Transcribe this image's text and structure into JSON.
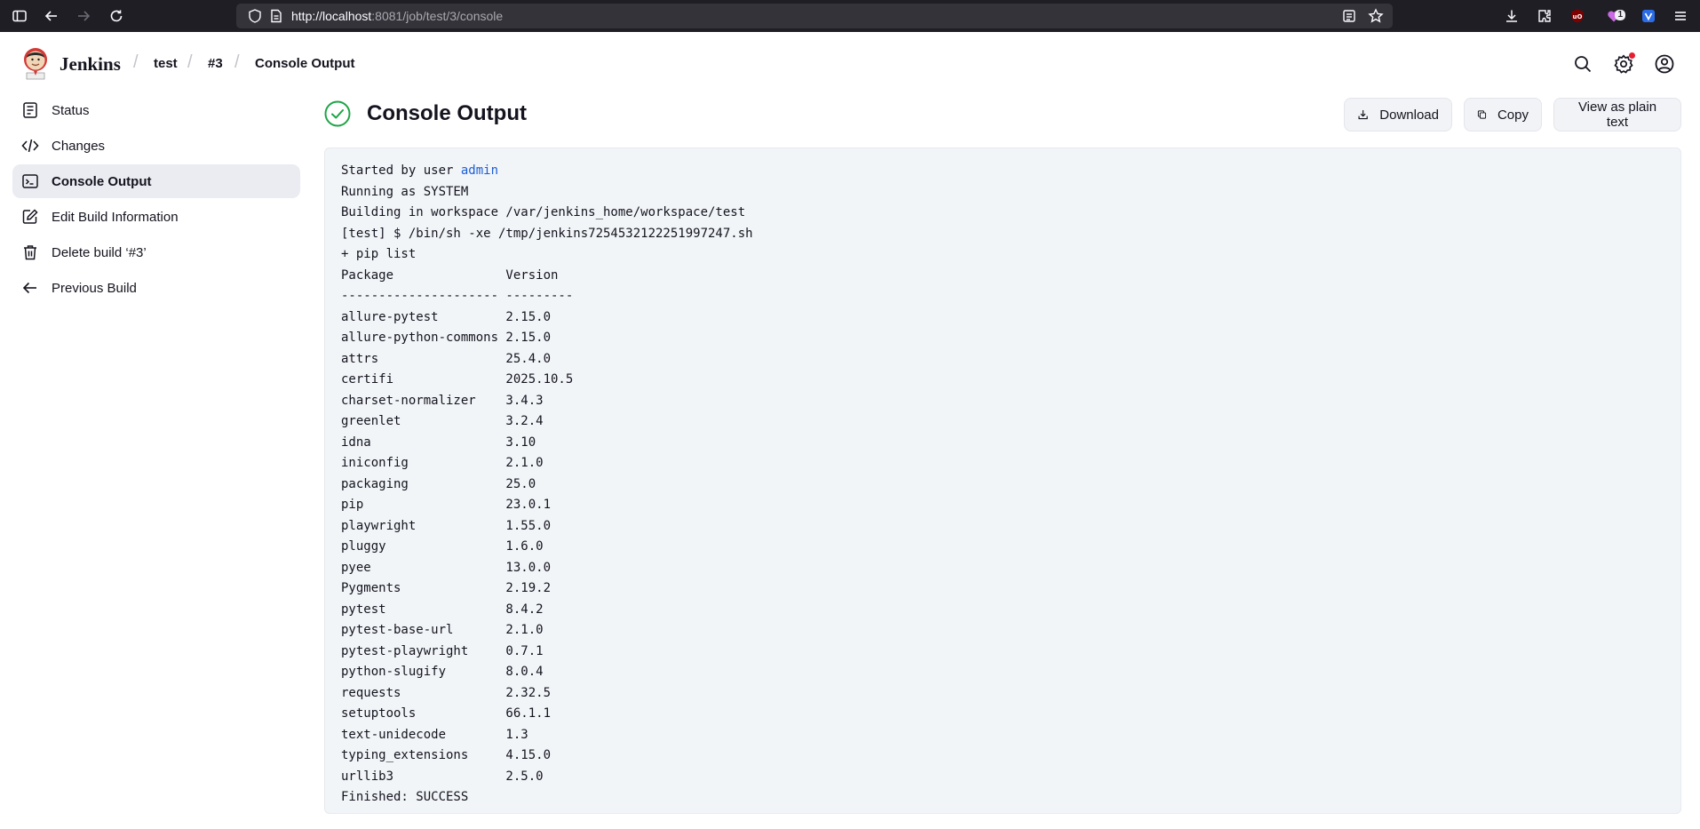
{
  "browser": {
    "url_host": "http://localhost",
    "url_rest": ":8081/job/test/3/console",
    "extension_badge": "1"
  },
  "header": {
    "brand": "Jenkins",
    "breadcrumbs": [
      "test",
      "#3",
      "Console Output"
    ]
  },
  "sidebar": {
    "items": [
      {
        "label": "Status",
        "icon": "status-icon"
      },
      {
        "label": "Changes",
        "icon": "code-icon"
      },
      {
        "label": "Console Output",
        "icon": "terminal-icon",
        "active": true
      },
      {
        "label": "Edit Build Information",
        "icon": "edit-icon"
      },
      {
        "label": "Delete build ‘#3’",
        "icon": "trash-icon"
      },
      {
        "label": "Previous Build",
        "icon": "arrow-left-icon"
      }
    ]
  },
  "main": {
    "title": "Console Output",
    "status": "success",
    "buttons": {
      "download": "Download",
      "copy": "Copy",
      "plain": "View as plain text"
    }
  },
  "console": {
    "started_prefix": "Started by user ",
    "started_user": "admin",
    "lines": [
      "Running as SYSTEM",
      "Building in workspace /var/jenkins_home/workspace/test",
      "[test] $ /bin/sh -xe /tmp/jenkins7254532122251997247.sh",
      "+ pip list",
      "Package               Version",
      "--------------------- ---------",
      "allure-pytest         2.15.0",
      "allure-python-commons 2.15.0",
      "attrs                 25.4.0",
      "certifi               2025.10.5",
      "charset-normalizer    3.4.3",
      "greenlet              3.2.4",
      "idna                  3.10",
      "iniconfig             2.1.0",
      "packaging             25.0",
      "pip                   23.0.1",
      "playwright            1.55.0",
      "pluggy                1.6.0",
      "pyee                  13.0.0",
      "Pygments              2.19.2",
      "pytest                8.4.2",
      "pytest-base-url       2.1.0",
      "pytest-playwright     0.7.1",
      "python-slugify        8.0.4",
      "requests              2.32.5",
      "setuptools            66.1.1",
      "text-unidecode        1.3",
      "typing_extensions     4.15.0",
      "urllib3               2.5.0",
      "Finished: SUCCESS"
    ]
  },
  "colors": {
    "success": "#1ea446",
    "link": "#1a5dd6",
    "active_bg": "#eaecf1"
  }
}
